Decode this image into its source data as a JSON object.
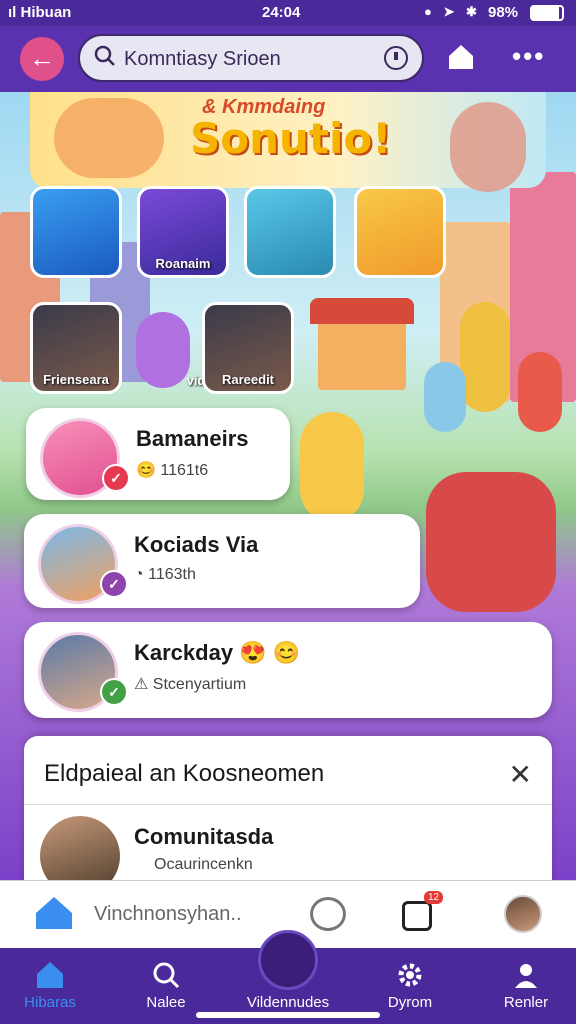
{
  "status_bar": {
    "carrier": "ıl Hibuan",
    "time": "24:04",
    "battery": "98%"
  },
  "search": {
    "value": "Komntiasy Srioen"
  },
  "banner": {
    "subtitle": "& Kmmdaing",
    "title": "Sonutio!"
  },
  "tiles": [
    {
      "label": ""
    },
    {
      "label": "Roanaim"
    },
    {
      "label": ""
    },
    {
      "label": ""
    }
  ],
  "photo_tiles": [
    {
      "label": "Frienseara"
    },
    {
      "label": "vid"
    },
    {
      "label": "Rareedit"
    }
  ],
  "cards": [
    {
      "title": "Bamaneirs",
      "meta": "1161t6",
      "badge_color": "#e53950"
    },
    {
      "title": "Kociads Via",
      "meta": "1163th",
      "badge_color": "#8e44ad"
    },
    {
      "title": "Karckday",
      "meta": "Stcenyartium",
      "badge_color": "#43a047"
    }
  ],
  "panel": {
    "title": "Eldpaieal an Koosneomen",
    "item_title": "Comunitasda",
    "item_meta": "Ocaurincenkn"
  },
  "tabbar": {
    "text": "Vinchnonsyhan..",
    "notif_count": "12"
  },
  "bottom_nav": {
    "items": [
      {
        "label": "Hibaras",
        "active": true
      },
      {
        "label": "Nalee",
        "active": false
      },
      {
        "label": "Vildennudes",
        "active": false
      },
      {
        "label": "Dyrom",
        "active": false
      },
      {
        "label": "Renler",
        "active": false
      }
    ]
  },
  "colors": {
    "primary": "#5a32b0",
    "nav": "#4a2a9a",
    "accent_pink": "#e0508a",
    "active_blue": "#3a8ef0"
  }
}
